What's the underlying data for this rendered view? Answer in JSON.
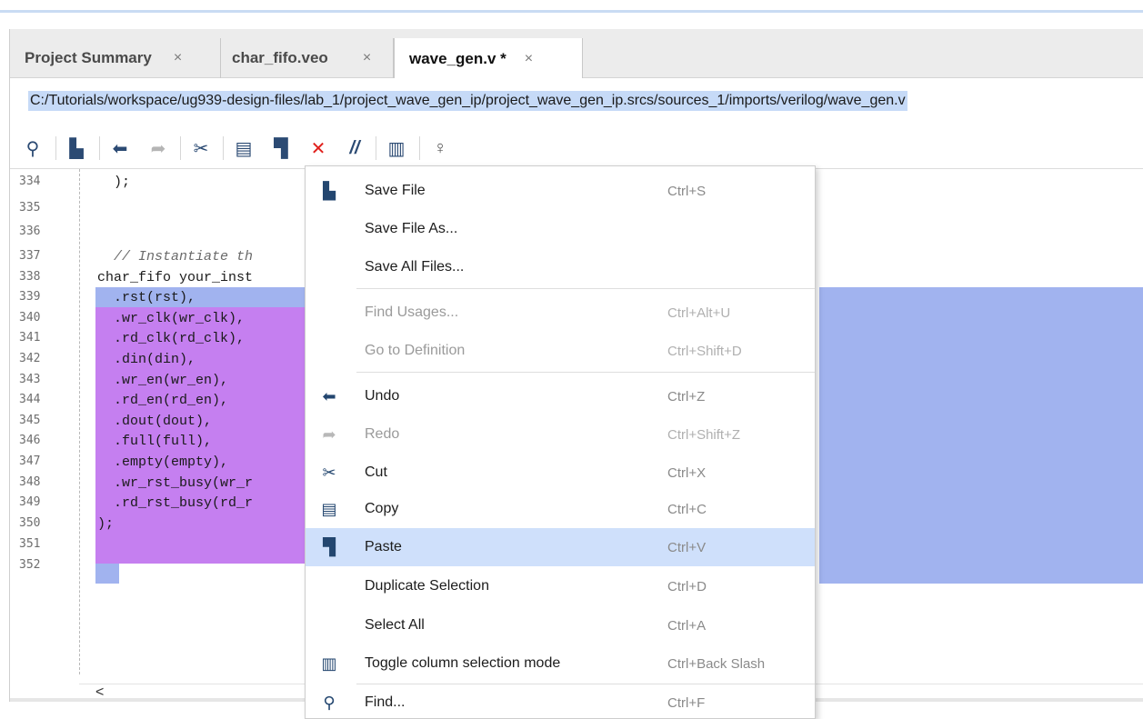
{
  "tabs": [
    {
      "label": "Project Summary",
      "close": "×"
    },
    {
      "label": "char_fifo.veo",
      "close": "×"
    },
    {
      "label": "wave_gen.v *",
      "close": "×",
      "active": true
    }
  ],
  "file_path": "C:/Tutorials/workspace/ug939-design-files/lab_1/project_wave_gen_ip/project_wave_gen_ip.srcs/sources_1/imports/verilog/wave_gen.v",
  "toolbar": {
    "icons": [
      "search-icon",
      "save-icon",
      "undo-icon",
      "redo-icon",
      "cut-icon",
      "copy-icon",
      "paste-icon",
      "delete-icon",
      "comment-icon",
      "column-mode-icon",
      "lightbulb-icon"
    ],
    "glyphs": {
      "search": "⚲",
      "save": "▙",
      "undo": "⬅",
      "redo": "➦",
      "cut": "✂",
      "copy": "▤",
      "paste": "▜",
      "delete": "✕",
      "comment": "//",
      "column": "▥",
      "bulb": "♀"
    }
  },
  "editor": {
    "lines": [
      {
        "n": "334",
        "text": "  );"
      },
      {
        "n": "335",
        "text": ""
      },
      {
        "n": "336",
        "text": ""
      },
      {
        "n": "337",
        "text": "  // Instantiate th",
        "comment": true
      },
      {
        "n": "338",
        "text": "char_fifo your_inst"
      },
      {
        "n": "339",
        "text": "  .rst(rst),"
      },
      {
        "n": "340",
        "text": "  .wr_clk(wr_clk),"
      },
      {
        "n": "341",
        "text": "  .rd_clk(rd_clk),"
      },
      {
        "n": "342",
        "text": "  .din(din),"
      },
      {
        "n": "343",
        "text": "  .wr_en(wr_en),"
      },
      {
        "n": "344",
        "text": "  .rd_en(rd_en),"
      },
      {
        "n": "345",
        "text": "  .dout(dout),"
      },
      {
        "n": "346",
        "text": "  .full(full),"
      },
      {
        "n": "347",
        "text": "  .empty(empty),"
      },
      {
        "n": "348",
        "text": "  .wr_rst_busy(wr_r"
      },
      {
        "n": "349",
        "text": "  .rd_rst_busy(rd_r"
      },
      {
        "n": "350",
        "text": ");"
      },
      {
        "n": "351",
        "text": ""
      },
      {
        "n": "352",
        "text": ""
      }
    ],
    "scroll_left_glyph": "<"
  },
  "context_menu": {
    "items": [
      {
        "label": "Save File",
        "shortcut": "Ctrl+S",
        "icon": "save-icon",
        "glyph": "▙"
      },
      {
        "label": "Save File As...",
        "shortcut": ""
      },
      {
        "label": "Save All Files...",
        "shortcut": ""
      },
      {
        "label": "Find Usages...",
        "shortcut": "Ctrl+Alt+U",
        "disabled": true
      },
      {
        "label": "Go to Definition",
        "shortcut": "Ctrl+Shift+D",
        "disabled": true
      },
      {
        "label": "Undo",
        "shortcut": "Ctrl+Z",
        "icon": "undo-icon",
        "glyph": "⬅"
      },
      {
        "label": "Redo",
        "shortcut": "Ctrl+Shift+Z",
        "icon": "redo-icon",
        "glyph": "➦",
        "disabled": true
      },
      {
        "label": "Cut",
        "shortcut": "Ctrl+X",
        "icon": "cut-icon",
        "glyph": "✂"
      },
      {
        "label": "Copy",
        "shortcut": "Ctrl+C",
        "icon": "copy-icon",
        "glyph": "▤"
      },
      {
        "label": "Paste",
        "shortcut": "Ctrl+V",
        "icon": "paste-icon",
        "glyph": "▜",
        "hover": true
      },
      {
        "label": "Duplicate Selection",
        "shortcut": "Ctrl+D"
      },
      {
        "label": "Select All",
        "shortcut": "Ctrl+A"
      },
      {
        "label": "Toggle column selection mode",
        "shortcut": "Ctrl+Back Slash",
        "icon": "column-mode-icon",
        "glyph": "▥"
      },
      {
        "label": "Find...",
        "shortcut": "Ctrl+F",
        "icon": "search-icon",
        "glyph": "⚲"
      }
    ]
  },
  "colors": {
    "selection_blue": "#a1b3ef",
    "selection_purple": "#c57ff0",
    "path_highlight": "#c6daf7",
    "menu_hover": "#cfe0fb",
    "delete_red": "#e0201c"
  }
}
